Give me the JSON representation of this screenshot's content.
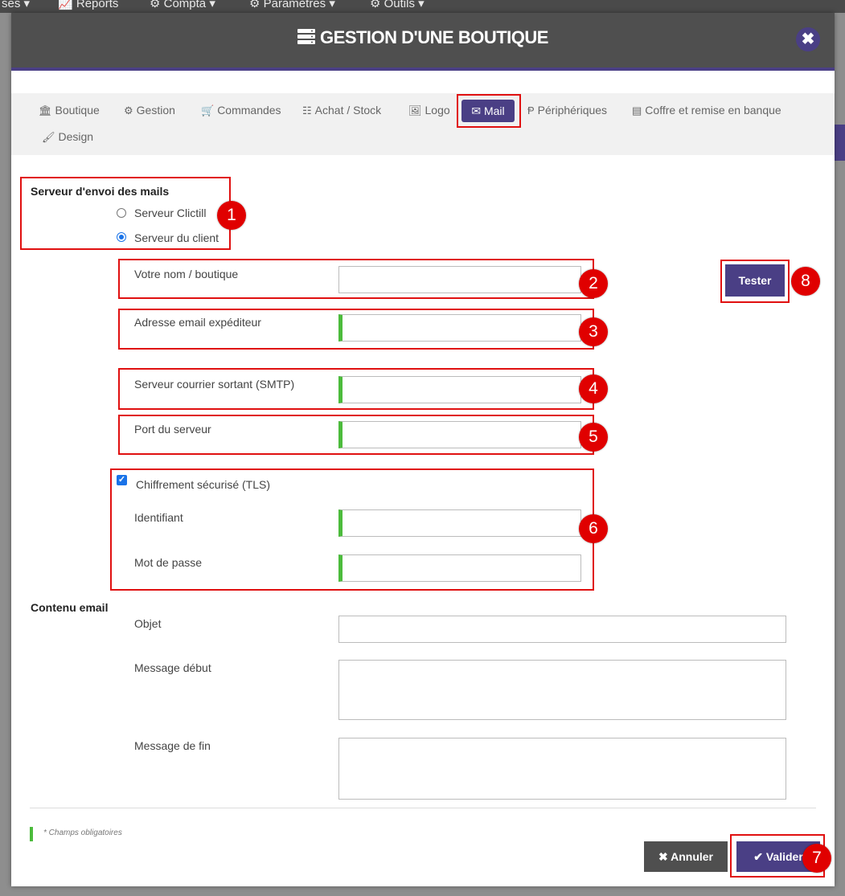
{
  "topnav": {
    "items": [
      "ses ▾",
      "Reports",
      "Compta ▾",
      "Paramètres ▾",
      "Outils ▾"
    ]
  },
  "modal": {
    "title": "GESTION D'UNE BOUTIQUE",
    "close_label": "✖"
  },
  "tabs": [
    {
      "label": "Boutique",
      "icon": "bank-icon"
    },
    {
      "label": "Gestion",
      "icon": "gears-icon"
    },
    {
      "label": "Commandes",
      "icon": "cart-icon"
    },
    {
      "label": "Achat / Stock",
      "icon": "grid-icon"
    },
    {
      "label": "Logo",
      "icon": "image-icon"
    },
    {
      "label": "Mail",
      "icon": "envelope-icon",
      "active": true
    },
    {
      "label": "Périphériques",
      "icon": "plug-icon"
    },
    {
      "label": "Coffre et remise en banque",
      "icon": "archive-icon"
    },
    {
      "label": "Design",
      "icon": "brush-icon"
    }
  ],
  "server_section": {
    "title": "Serveur d'envoi des mails",
    "options": [
      "Serveur Clictill",
      "Serveur du client"
    ],
    "selected_index": 1
  },
  "fields": {
    "shop_name": {
      "label": "Votre nom / boutique",
      "value": ""
    },
    "sender_email": {
      "label": "Adresse email expéditeur",
      "value": ""
    },
    "smtp_server": {
      "label": "Serveur courrier sortant (SMTP)",
      "value": ""
    },
    "server_port": {
      "label": "Port du serveur",
      "value": ""
    },
    "tls": {
      "label": "Chiffrement sécurisé (TLS)",
      "checked": true
    },
    "username": {
      "label": "Identifiant",
      "value": ""
    },
    "password": {
      "label": "Mot de passe",
      "value": ""
    }
  },
  "content_section": {
    "title": "Contenu email",
    "subject_label": "Objet",
    "start_message_label": "Message début",
    "end_message_label": "Message de fin"
  },
  "buttons": {
    "test": "Tester",
    "cancel": "Annuler",
    "validate": "Valider"
  },
  "required_note": "* Champs obligatoires",
  "annotations": [
    "1",
    "2",
    "3",
    "4",
    "5",
    "6",
    "7",
    "8"
  ],
  "colors": {
    "accent": "#4a3f85",
    "header": "#4f4f4f",
    "annotation_red": "#e00000",
    "required_green": "#4cbb3c"
  }
}
